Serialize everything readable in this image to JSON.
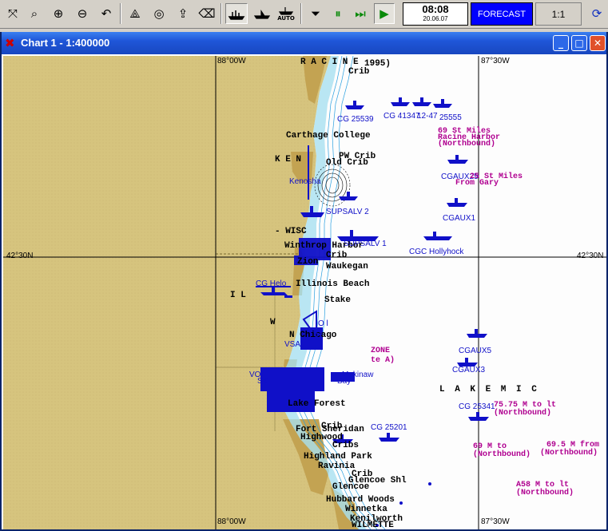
{
  "window": {
    "title": "Chart 1 - 1:400000",
    "controls": {
      "minimize": "_",
      "maximize": "□",
      "close": "✕"
    }
  },
  "toolbar": {
    "clock_time": "08:08",
    "clock_date": "20.06.07",
    "forecast_label": "FORECAST",
    "scale_label": "1:1",
    "auto_label": "AUTO",
    "buttons": [
      {
        "name": "fit-icon",
        "glyph": "⤧"
      },
      {
        "name": "zoom-window-icon",
        "glyph": "⌕"
      },
      {
        "name": "zoom-in-icon",
        "glyph": "⊕"
      },
      {
        "name": "zoom-out-icon",
        "glyph": "⊖"
      },
      {
        "name": "undo-icon",
        "glyph": "↶"
      },
      {
        "name": "compass-icon",
        "glyph": "⟁"
      },
      {
        "name": "target-icon",
        "glyph": "◎"
      },
      {
        "name": "export-icon",
        "glyph": "⇪"
      },
      {
        "name": "delete-icon",
        "glyph": "⌫"
      },
      {
        "name": "stop-icon",
        "glyph": "⏷"
      },
      {
        "name": "pause-icon",
        "glyph": "⏸"
      },
      {
        "name": "fast-forward-icon",
        "glyph": "⏭"
      },
      {
        "name": "play-icon",
        "glyph": "▶"
      },
      {
        "name": "refresh-icon",
        "glyph": "⟳"
      }
    ]
  },
  "grid": {
    "lon_88": "88°00W",
    "lon_8730": "87°30W",
    "lat_4230": "42°30N"
  },
  "places": {
    "racine": "R A C I N E",
    "y1995": "1995)",
    "crib1": "Crib",
    "carthage": "Carthage College",
    "kenosha_caps": "K E N",
    "pwcrib": "PW Crib",
    "old_crib": "Old Crib",
    "kenosha": "Kenosha",
    "wisconsin": "- WISC",
    "winthrop": "Winthrop Harbor",
    "crib2": "Crib",
    "zion": "Zion",
    "waukegan": "Waukegan",
    "illinois_beach": "Illinois Beach",
    "il": "I L",
    "stake": "Stake",
    "w": "W",
    "north_chicago": "N Chicago",
    "lake_forest": "Lake Forest",
    "crib3": "Crib",
    "fort_sheridan": "Fort Sheridan",
    "highwood": "Highwood",
    "cribs": "Cribs",
    "highland_park": "Highland Park",
    "ravinia": "Ravinia",
    "crib4": "Crib",
    "glencoe_shl": "Glencoe Shl",
    "glencoe": "Glencoe",
    "hubbard": "Hubbard Woods",
    "winnetka": "Winnetka",
    "kenilworth": "Kenilworth",
    "wilmette": "WILMETTE",
    "lake_michigan": "L A K E   M I C"
  },
  "vessels": {
    "cg25539": "CG 25539",
    "cg41": "CG 41347",
    "cg12": "12-47",
    "cg555": "25555",
    "cgaux25": "CGAUX25",
    "cgaux1": "CGAUX1",
    "supsalv2": "SUPSALV 2",
    "supsalv1": "SUPSALV 1",
    "hollyhock": "CGC Hollyhock",
    "cg_helo": "CG Helo",
    "cgaux5": "CGAUX5",
    "cgaux3": "CGAUX3",
    "cg2534": "CG 25341",
    "cg25201": "CG 25201",
    "makinaw": "Makinaw",
    "vo": "VO",
    "sk": "SK",
    "bay": "Bay",
    "ol": "O l",
    "ti": "Ti",
    "vsa": "VSA"
  },
  "routes": {
    "r69": "69 St Miles",
    "racine_harbor": "Racine Harbor",
    "northbound1": "(Northbound)",
    "from_gary": "25 St Miles",
    "from_gary2": "From Gary",
    "zone": "ZONE",
    "note_a": "te A)",
    "r75": "75.75 M to lt",
    "northbound2": "(Northbound)",
    "r69b": "69 M to",
    "r695": "69.5 M from",
    "northbound3": "(Northbound)",
    "northbound4": "(Northbound)",
    "a58": "A58 M to lt",
    "northbound5": "(Northbound)"
  },
  "colors": {
    "land": "#d6c47e",
    "land_dark": "#c3a352",
    "water": "#fdfdfd",
    "shallow": "#a8e0f0",
    "vessel": "#1010c8",
    "route": "#b00090",
    "title_bar": "#1f56d8"
  }
}
